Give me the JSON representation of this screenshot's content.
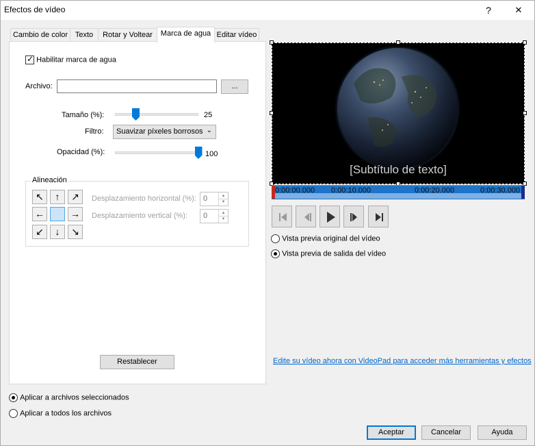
{
  "window": {
    "title": "Efectos de vídeo",
    "help_glyph": "?",
    "close_glyph": "✕"
  },
  "tabs": [
    {
      "label": "Cambio de color",
      "active": false
    },
    {
      "label": "Texto",
      "active": false
    },
    {
      "label": "Rotar y Voltear",
      "active": false
    },
    {
      "label": "Marca de agua",
      "active": true
    },
    {
      "label": "Editar vídeo",
      "active": false
    }
  ],
  "watermark": {
    "enable_label": "Habilitar marca de agua",
    "enable_checked": true,
    "file_label": "Archivo:",
    "file_value": "",
    "browse_label": "...",
    "size_label": "Tamaño (%):",
    "size_value": "25",
    "size_fraction": 0.25,
    "filter_label": "Filtro:",
    "filter_value": "Suavizar píxeles borrosos",
    "opacity_label": "Opacidad (%):",
    "opacity_value": "100",
    "opacity_fraction": 1.0,
    "alignment_label": "Alineación",
    "arrows": {
      "top_left": "↖",
      "top": "↑",
      "top_right": "↗",
      "left": "←",
      "center": "",
      "right": "→",
      "bottom_left": "↙",
      "bottom": "↓",
      "bottom_right": "↘"
    },
    "h_offset_label": "Desplazamiento horizontal (%):",
    "h_offset_value": "0",
    "v_offset_label": "Desplazamiento vertical (%):",
    "v_offset_value": "0",
    "reset_label": "Restablecer"
  },
  "preview": {
    "overlay_text": "[Subtítulo de texto]",
    "timeline": [
      "0:00:00.000",
      "0:00:10.000",
      "0:00:20.000",
      "0:00:30.000"
    ],
    "accent": "#1f74c9",
    "original_label": "Vista previa original del vídeo",
    "output_label": "Vista previa de salida del vídeo",
    "selected_mode": "output",
    "videopad_link": "Edite su vídeo ahora con VideoPad para acceder más herramientas y efectos"
  },
  "apply": {
    "selected_label": "Aplicar a archivos seleccionados",
    "all_label": "Aplicar a todos los archivos",
    "selected_option": "selected"
  },
  "footer": {
    "ok_label": "Aceptar",
    "cancel_label": "Cancelar",
    "help_label": "Ayuda"
  }
}
